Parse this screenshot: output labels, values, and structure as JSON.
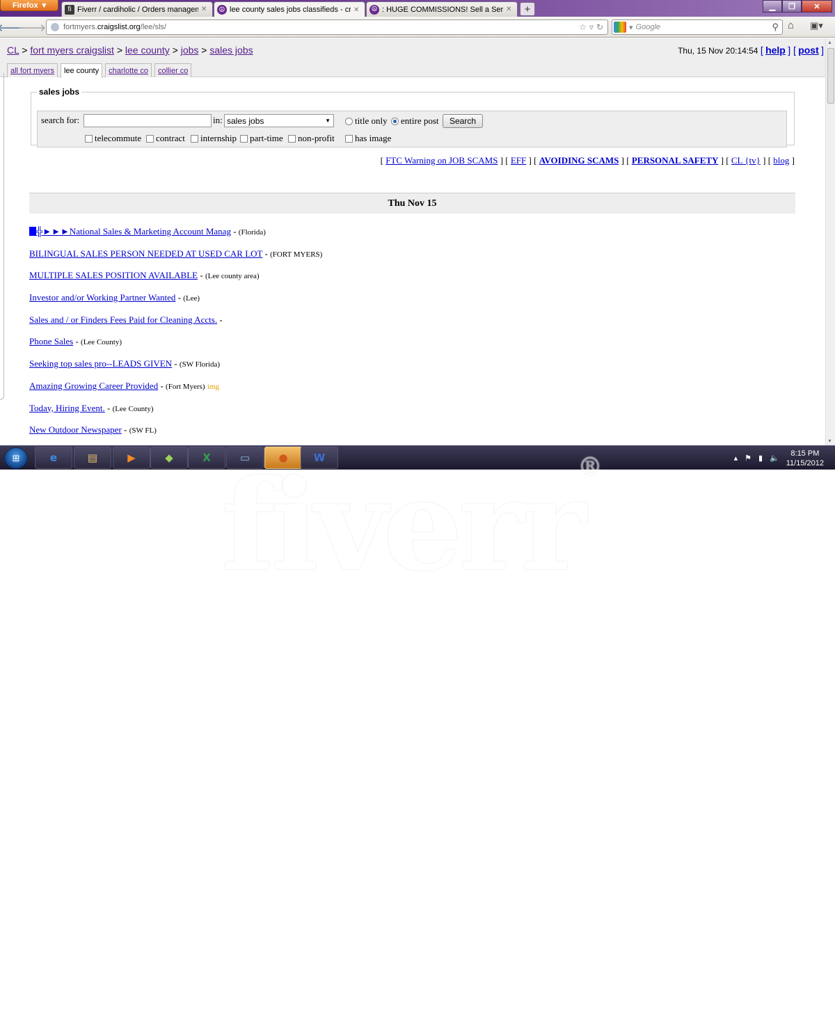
{
  "browser": {
    "menu_button": "Firefox",
    "tabs": [
      {
        "label": "Fiverr / cardiholic / Orders managem...",
        "icon": "fiverr-icon"
      },
      {
        "label": "lee county sales jobs classifieds - crai...",
        "icon": "peace-icon",
        "active": true
      },
      {
        "label": ": HUGE COMMISSIONS! Sell a Service ...",
        "icon": "peace-icon"
      }
    ],
    "new_tab": "+",
    "url_prefix": "fortmyers.",
    "url_host": "craigslist.org",
    "url_path": "/lee/sls/",
    "search_placeholder": "Google"
  },
  "page": {
    "breadcrumbs": [
      {
        "label": "CL"
      },
      {
        "label": "fort myers craigslist"
      },
      {
        "label": "lee county"
      },
      {
        "label": "jobs"
      },
      {
        "label": "sales jobs"
      }
    ],
    "timestamp": "Thu, 15 Nov 20:14:54",
    "help_label": "help",
    "post_label": "post",
    "area_tabs": [
      "all fort myers",
      "lee county",
      "charlotte co",
      "collier co"
    ],
    "current_area": "lee county",
    "search": {
      "legend": "sales jobs",
      "search_for_label": "search for:",
      "query": "",
      "in_label": "in:",
      "category": "sales jobs",
      "title_only_label": "title only",
      "entire_post_label": "entire post",
      "selected_scope": "entire post",
      "button_label": "Search",
      "checkboxes": [
        "telecommute",
        "contract",
        "internship",
        "part-time",
        "non-profit",
        "has image"
      ]
    },
    "warning_links": [
      {
        "label": "FTC Warning on JOB SCAMS",
        "bold": false
      },
      {
        "label": "EFF",
        "bold": false
      },
      {
        "label": "AVOIDING SCAMS",
        "bold": true
      },
      {
        "label": "PERSONAL SAFETY",
        "bold": true
      },
      {
        "label": "CL {tv}",
        "bold": false
      },
      {
        "label": "blog",
        "bold": false
      }
    ],
    "day_header": "Thu Nov 15",
    "listings": [
      {
        "title": "╬►►►National Sales & Marketing Account Manag",
        "location": "(Florida)",
        "has_image": false,
        "prefix_block": true
      },
      {
        "title": "BILINGUAL SALES PERSON NEEDED AT USED CAR LOT",
        "location": "(FORT MYERS)",
        "has_image": false
      },
      {
        "title": "MULTIPLE SALES POSITION AVAILABLE",
        "location": "(Lee county area)",
        "has_image": false
      },
      {
        "title": "Investor and/or Working Partner Wanted",
        "location": "(Lee)",
        "has_image": false
      },
      {
        "title": "Sales and / or Finders Fees Paid for Cleaning Accts.",
        "location": "",
        "has_image": false
      },
      {
        "title": "Phone Sales",
        "location": "(Lee County)",
        "has_image": false
      },
      {
        "title": "Seeking top sales pro--LEADS GIVEN",
        "location": "(SW Florida)",
        "has_image": false
      },
      {
        "title": "Amazing Growing Career Provided",
        "location": "(Fort Myers)",
        "has_image": true,
        "image_tag": "img"
      },
      {
        "title": "Today, Hiring Event.",
        "location": "(Lee County)",
        "has_image": false
      },
      {
        "title": "New Outdoor Newspaper",
        "location": "(SW FL)",
        "has_image": false
      }
    ]
  },
  "taskbar": {
    "apps": [
      "internet-explorer-icon",
      "windows-explorer-icon",
      "media-player-icon",
      "folder-icon",
      "excel-icon",
      "screen-capture-icon",
      "firefox-icon",
      "word-icon"
    ],
    "active_app": "firefox-icon",
    "time": "8:15 PM",
    "date": "11/15/2012"
  },
  "watermark": {
    "text": "fiverr",
    "mark": "®"
  },
  "colors": {
    "link": "#0000cc",
    "visited": "#551a8b",
    "header_bg": "#eeeeee",
    "img_tag": "#e2a000"
  }
}
